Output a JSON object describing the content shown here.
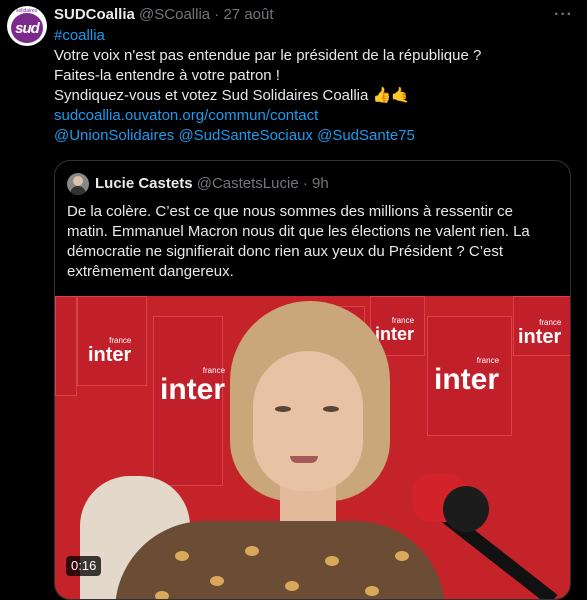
{
  "tweet": {
    "avatar_text": "sud",
    "avatar_small": "solidaires",
    "display_name": "SUDCoallia",
    "handle": "@SCoallia",
    "separator": "·",
    "date": "27 août",
    "more_icon": "more-horizontal-icon",
    "lines": [
      {
        "text": "#coallia",
        "link": true
      },
      {
        "text": "Votre voix n'est pas entendue par le président de la république ?",
        "link": false
      },
      {
        "text": "Faites-la entendre à votre patron !",
        "link": false
      },
      {
        "text": "Syndiquez-vous et votez Sud Solidaires Coallia 👍🤙",
        "link": false
      },
      {
        "text": "sudcoallia.ouvaton.org/commun/contact",
        "link": true
      },
      {
        "text": "@UnionSolidaires @SudSanteSociaux @SudSante75",
        "link": true
      }
    ]
  },
  "quote": {
    "display_name": "Lucie Castets",
    "handle": "@CastetsLucie",
    "separator": "·",
    "time": "9h",
    "lines": [
      "De la colère. C’est ce que nous sommes des millions à ressentir ce",
      "matin. Emmanuel Macron nous dit que les élections ne valent rien. La",
      "démocratie ne signifierait donc rien aux yeux du Président ? C’est",
      "extrêmement dangereux."
    ],
    "video": {
      "duration": "0:16",
      "logo_main": "inter",
      "logo_small": "france"
    }
  },
  "colors": {
    "background": "#000000",
    "text": "#e7e9ea",
    "muted": "#71767b",
    "link": "#1d9bf0",
    "border": "#2f3336",
    "studio_red": "#c5232a"
  }
}
